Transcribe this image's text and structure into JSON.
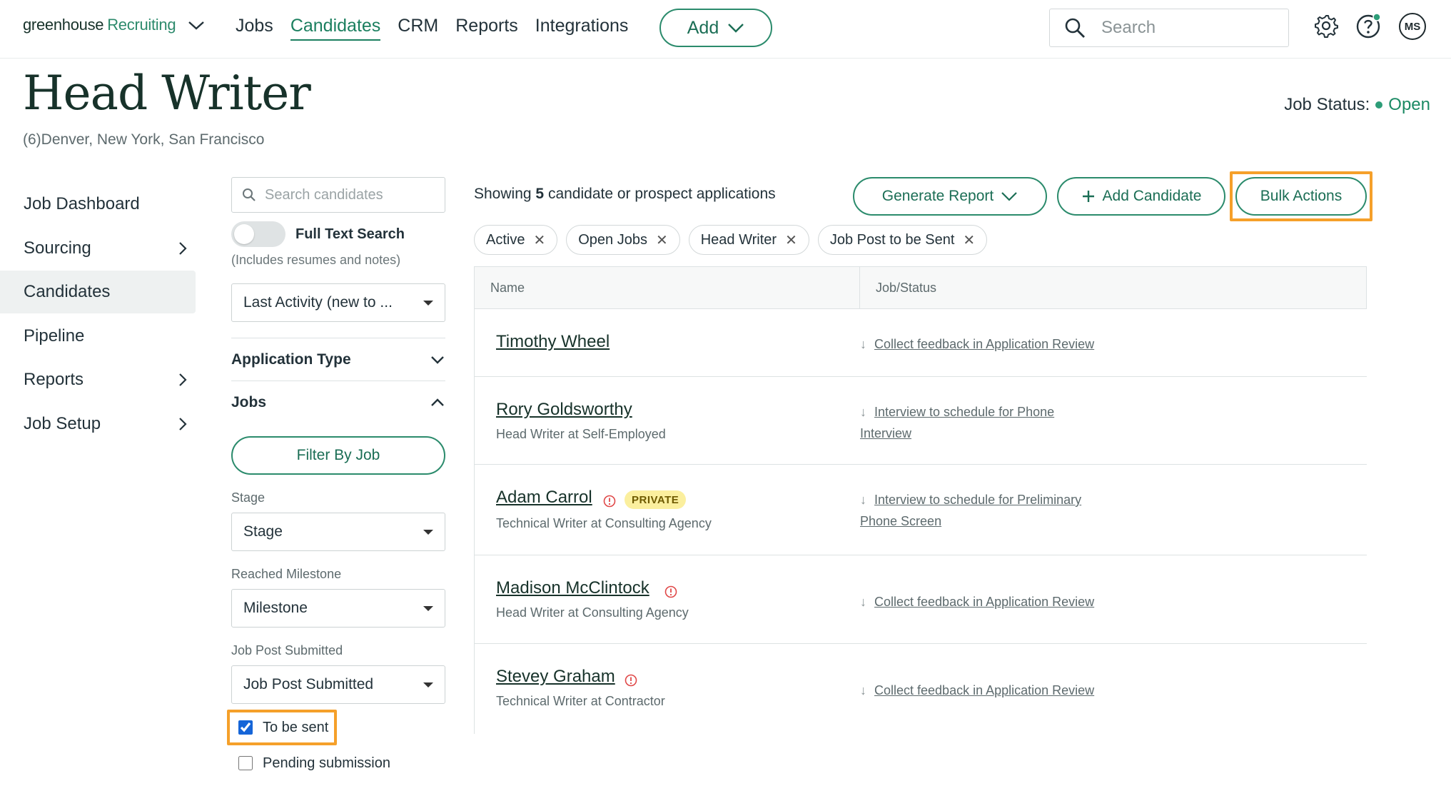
{
  "nav": {
    "logo_primary": "greenhouse",
    "logo_secondary": "Recruiting",
    "links": [
      "Jobs",
      "Candidates",
      "CRM",
      "Reports",
      "Integrations"
    ],
    "add_label": "Add",
    "search_placeholder": "Search",
    "avatar_initials": "MS"
  },
  "header": {
    "title": "Head Writer",
    "locations": "(6)Denver, New York, San Francisco",
    "status_label": "Job Status:",
    "status_value": "Open"
  },
  "sidebar": {
    "items": [
      "Job Dashboard",
      "Sourcing",
      "Candidates",
      "Pipeline",
      "Reports",
      "Job Setup"
    ]
  },
  "filters": {
    "search_placeholder": "Search candidates",
    "full_text_label": "Full Text Search",
    "full_text_hint": "(Includes resumes and notes)",
    "sort_value": "Last Activity (new to ...",
    "application_type": "Application Type",
    "jobs": "Jobs",
    "filter_by_job": "Filter By Job",
    "stage_label": "Stage",
    "stage_value": "Stage",
    "milestone_label": "Reached Milestone",
    "milestone_value": "Milestone",
    "job_post_label": "Job Post Submitted",
    "job_post_value": "Job Post Submitted",
    "opt_to_be_sent": "To be sent",
    "opt_pending": "Pending submission"
  },
  "main": {
    "showing_prefix": "Showing",
    "showing_count": "5",
    "showing_suffix": "candidate or prospect applications",
    "generate_report": "Generate Report",
    "add_candidate": "Add Candidate",
    "bulk_actions": "Bulk Actions",
    "chips": [
      "Active",
      "Open Jobs",
      "Head Writer",
      "Job Post to be Sent"
    ],
    "col_name": "Name",
    "col_job_status": "Job/Status",
    "candidates": [
      {
        "name": "Timothy Wheel",
        "title": "",
        "status": "Collect feedback in Application Review"
      },
      {
        "name": "Rory Goldsworthy",
        "title": "Head Writer at Self-Employed",
        "status": "Interview to schedule for Phone Interview"
      },
      {
        "name": "Adam Carrol",
        "title": "Technical Writer at Consulting Agency",
        "status": "Interview to schedule for Preliminary Phone Screen",
        "badge": "PRIVATE"
      },
      {
        "name": "Madison McClintock",
        "title": "Head Writer at Consulting Agency",
        "status": "Collect feedback in Application Review"
      },
      {
        "name": "Stevey Graham",
        "title": "Technical Writer at Contractor",
        "status": "Collect feedback in Application Review"
      }
    ]
  }
}
